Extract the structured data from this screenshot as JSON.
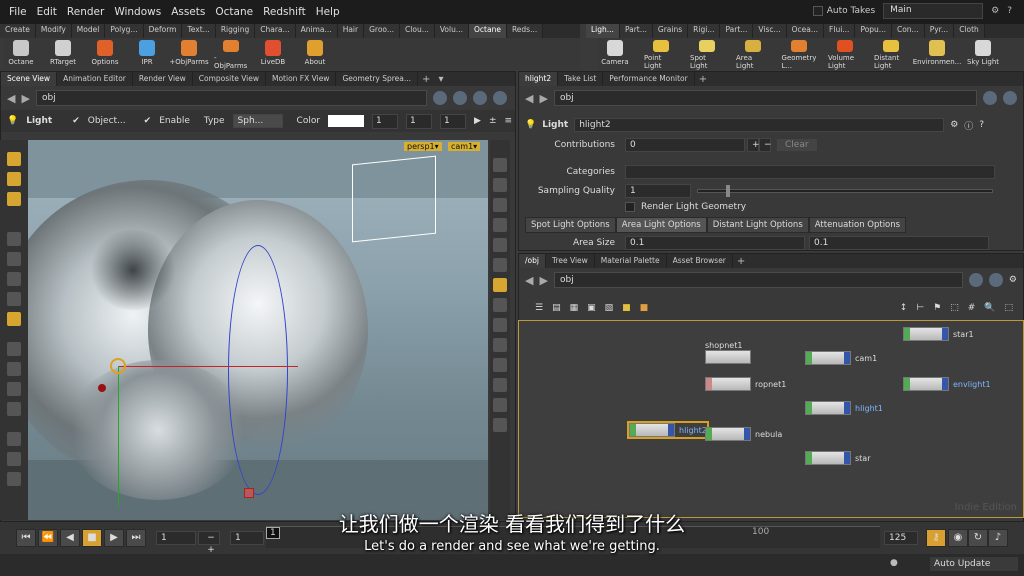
{
  "menu": [
    "File",
    "Edit",
    "Render",
    "Windows",
    "Assets",
    "Octane",
    "Redshift",
    "Help"
  ],
  "autotakes": "Auto Takes",
  "desktop": "Main",
  "shelf_tabs_left": [
    "Create",
    "Modify",
    "Model",
    "Polyg...",
    "Deform",
    "Text...",
    "Rigging",
    "Chara...",
    "Anima...",
    "Hair",
    "Groo...",
    "Clou...",
    "Volu...",
    "Octane",
    "Reds..."
  ],
  "shelf_tabs_right": [
    "Ligh...",
    "Part...",
    "Grains",
    "Rigi...",
    "Part...",
    "Visc...",
    "Ocea...",
    "Flui...",
    "Popu...",
    "Con...",
    "Pyr...",
    "Cloth"
  ],
  "tools_left": [
    "Octane",
    "RTarget",
    "Options",
    "IPR",
    "+ObjParms",
    "-ObjParms",
    "LiveDB",
    "About"
  ],
  "tools_right": [
    "Camera",
    "Point Light",
    "Spot Light",
    "Area Light",
    "Geometry L...",
    "Volume Light",
    "Distant Light",
    "Environmen...",
    "Sky Light"
  ],
  "left_pane": {
    "tabs": [
      "Scene View",
      "Animation Editor",
      "Render View",
      "Composite View",
      "Motion FX View",
      "Geometry Sprea..."
    ],
    "path": "obj",
    "light_label": "Light",
    "object_label": "Object...",
    "enable_label": "Enable",
    "type_label": "Type",
    "type_value": "Sph...",
    "color_label": "Color",
    "color_values": [
      "1",
      "1",
      "1"
    ],
    "cam_tags": [
      "persp1▾",
      "cam1▾"
    ]
  },
  "param_pane": {
    "tabs": [
      "hlight2",
      "Take List",
      "Performance Monitor"
    ],
    "path": "obj",
    "node_type": "Light",
    "node_name": "hlight2",
    "contributions_label": "Contributions",
    "contributions_value": "0",
    "clear_label": "Clear",
    "categories_label": "Categories",
    "sampling_label": "Sampling Quality",
    "sampling_value": "1",
    "render_geo_label": "Render Light Geometry",
    "sub_tabs": [
      "Spot Light Options",
      "Area Light Options",
      "Distant Light Options",
      "Attenuation Options"
    ],
    "area_size_label": "Area Size",
    "area_size_values": [
      "0.1",
      "0.1"
    ]
  },
  "net_pane": {
    "tabs": [
      "/obj",
      "Tree View",
      "Material Palette",
      "Asset Browser"
    ],
    "path": "obj",
    "watermark": "Indie Edition",
    "nodes": [
      {
        "name": "shopnet1"
      },
      {
        "name": "star1"
      },
      {
        "name": "cam1"
      },
      {
        "name": "ropnet1"
      },
      {
        "name": "envlight1"
      },
      {
        "name": "hlight1"
      },
      {
        "name": "hlight2"
      },
      {
        "name": "nebula"
      },
      {
        "name": "star"
      }
    ]
  },
  "timeline": {
    "frame": "1",
    "start": "1",
    "end": "125",
    "tick_100": "100",
    "playhead": "1"
  },
  "status": {
    "auto_update": "Auto Update"
  },
  "subtitle": {
    "zh": "让我们做一个渲染 看看我们得到了什么",
    "en": "Let's do a render and see what we're getting."
  }
}
